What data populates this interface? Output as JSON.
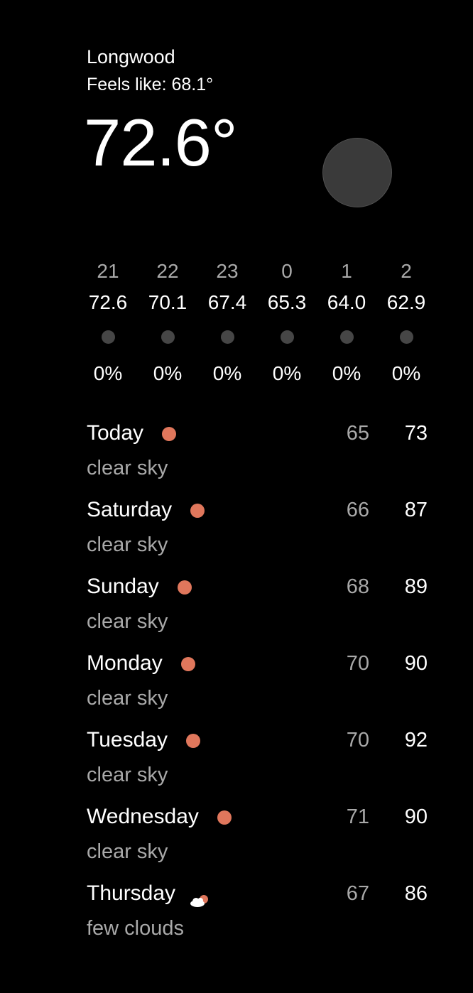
{
  "current": {
    "location": "Longwood",
    "feels_like": "Feels like: 68.1°",
    "temperature": "72.6°",
    "icon": "moon-icon",
    "icon_color": "#3a3a3a"
  },
  "hourly": [
    {
      "time": "21",
      "temp": "72.6",
      "icon": "night-clear-icon",
      "pop": "0%"
    },
    {
      "time": "22",
      "temp": "70.1",
      "icon": "night-clear-icon",
      "pop": "0%"
    },
    {
      "time": "23",
      "temp": "67.4",
      "icon": "night-clear-icon",
      "pop": "0%"
    },
    {
      "time": "0",
      "temp": "65.3",
      "icon": "night-clear-icon",
      "pop": "0%"
    },
    {
      "time": "1",
      "temp": "64.0",
      "icon": "night-clear-icon",
      "pop": "0%"
    },
    {
      "time": "2",
      "temp": "62.9",
      "icon": "night-clear-icon",
      "pop": "0%"
    }
  ],
  "daily": [
    {
      "day": "Today",
      "description": "clear sky",
      "low": "65",
      "high": "73",
      "icon": "sun-icon"
    },
    {
      "day": "Saturday",
      "description": "clear sky",
      "low": "66",
      "high": "87",
      "icon": "sun-icon"
    },
    {
      "day": "Sunday",
      "description": "clear sky",
      "low": "68",
      "high": "89",
      "icon": "sun-icon"
    },
    {
      "day": "Monday",
      "description": "clear sky",
      "low": "70",
      "high": "90",
      "icon": "sun-icon"
    },
    {
      "day": "Tuesday",
      "description": "clear sky",
      "low": "70",
      "high": "92",
      "icon": "sun-icon"
    },
    {
      "day": "Wednesday",
      "description": "clear sky",
      "low": "71",
      "high": "90",
      "icon": "sun-icon"
    },
    {
      "day": "Thursday",
      "description": "few clouds",
      "low": "67",
      "high": "86",
      "icon": "few-clouds-icon"
    }
  ],
  "colors": {
    "background": "#000000",
    "text_primary": "#ffffff",
    "text_secondary": "#a9a9a9",
    "sun": "#e0775c",
    "night_dot": "#464646"
  }
}
